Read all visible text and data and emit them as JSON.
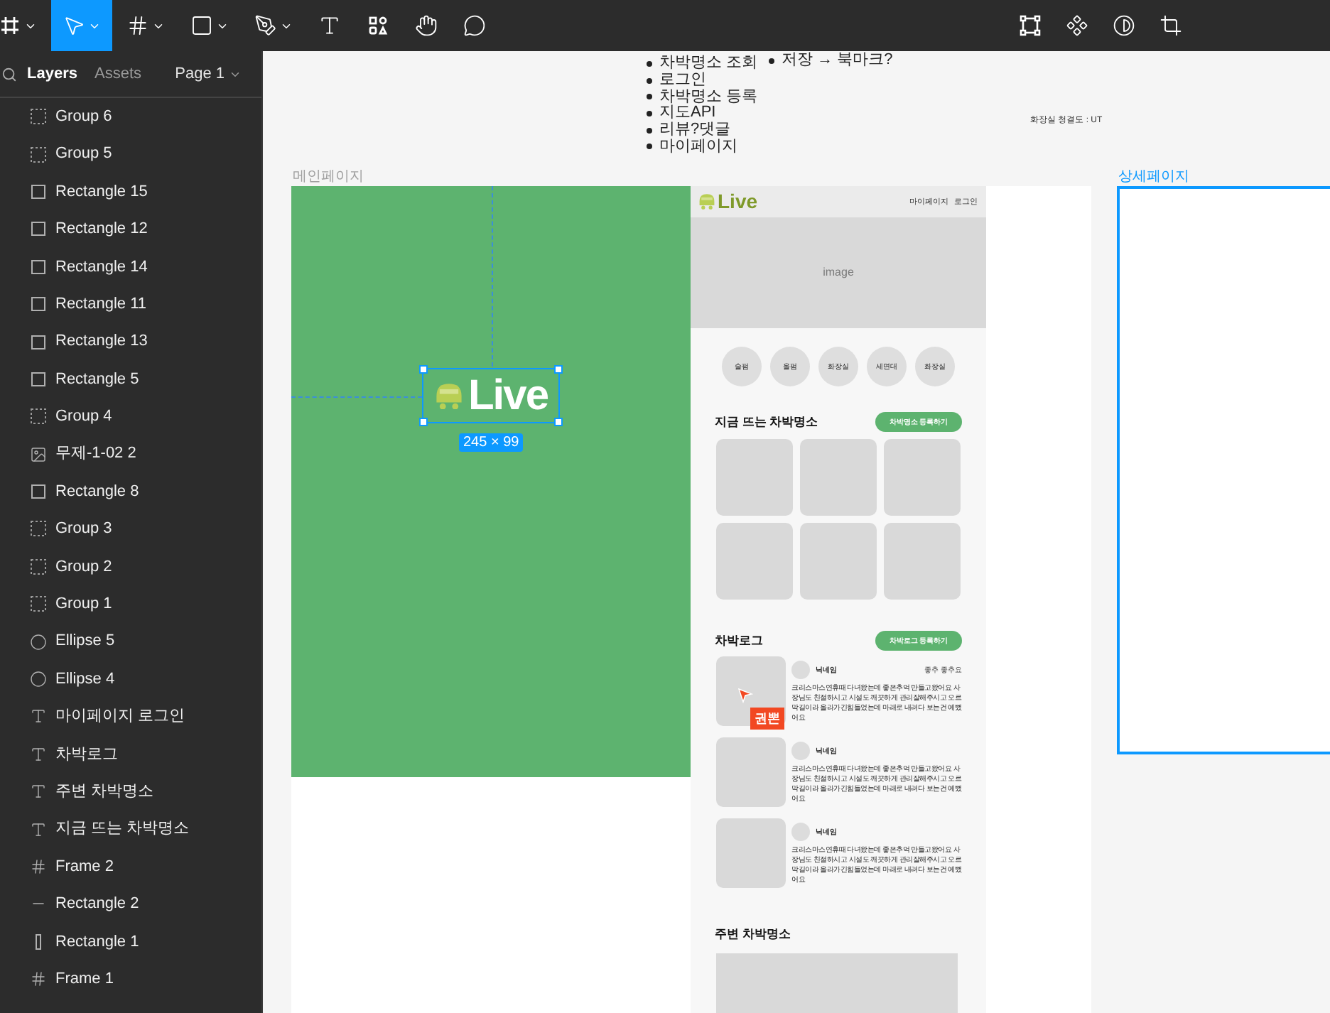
{
  "toolbar": {
    "tools": [
      {
        "kind": "menu",
        "selected": false,
        "menu": true
      },
      {
        "kind": "move",
        "selected": true,
        "menu": true
      },
      {
        "kind": "frame",
        "selected": false,
        "menu": true
      },
      {
        "kind": "rectangle",
        "selected": false,
        "menu": true
      },
      {
        "kind": "pen",
        "selected": false,
        "menu": true
      },
      {
        "kind": "text",
        "selected": false,
        "menu": false
      },
      {
        "kind": "resources",
        "selected": false,
        "menu": false
      },
      {
        "kind": "hand",
        "selected": false,
        "menu": false
      },
      {
        "kind": "comment",
        "selected": false,
        "menu": false
      }
    ],
    "right_tools": [
      {
        "kind": "frame-selection"
      },
      {
        "kind": "component"
      },
      {
        "kind": "contrast"
      },
      {
        "kind": "crop"
      }
    ]
  },
  "layers_panel": {
    "tabs": [
      {
        "label": "Layers",
        "selected": true
      },
      {
        "label": "Assets",
        "selected": false
      }
    ],
    "page": "Page 1",
    "layers": [
      {
        "name": "Group 6",
        "kind": "group"
      },
      {
        "name": "Group 5",
        "kind": "group"
      },
      {
        "name": "Rectangle 15",
        "kind": "rectangle"
      },
      {
        "name": "Rectangle 12",
        "kind": "rectangle"
      },
      {
        "name": "Rectangle 14",
        "kind": "rectangle"
      },
      {
        "name": "Rectangle 11",
        "kind": "rectangle"
      },
      {
        "name": "Rectangle 13",
        "kind": "rectangle"
      },
      {
        "name": "Rectangle 5",
        "kind": "rectangle"
      },
      {
        "name": "Group 4",
        "kind": "group"
      },
      {
        "name": "무제-1-02 2",
        "kind": "image"
      },
      {
        "name": "Rectangle 8",
        "kind": "rectangle"
      },
      {
        "name": "Group 3",
        "kind": "group"
      },
      {
        "name": "Group 2",
        "kind": "group"
      },
      {
        "name": "Group 1",
        "kind": "group"
      },
      {
        "name": "Ellipse 5",
        "kind": "ellipse"
      },
      {
        "name": "Ellipse 4",
        "kind": "ellipse"
      },
      {
        "name": "마이페이지 로그인",
        "kind": "text"
      },
      {
        "name": "차박로그",
        "kind": "text"
      },
      {
        "name": "주변 차박명소",
        "kind": "text"
      },
      {
        "name": "지금 뜨는 차박명소",
        "kind": "text"
      },
      {
        "name": "Frame 2",
        "kind": "frame"
      },
      {
        "name": "Rectangle 2",
        "kind": "line"
      },
      {
        "name": "Rectangle 1",
        "kind": "bar"
      },
      {
        "name": "Frame 1",
        "kind": "frame"
      }
    ]
  },
  "canvas": {
    "notes": [
      "차박명소 조회",
      "로그인",
      "차박명소 등록",
      "지도API",
      "리뷰?댓글",
      "마이페이지"
    ],
    "side_notes": [
      "저장 → 북마크?"
    ],
    "caption": "화장실 청결도 : UT",
    "main_frame": {
      "label": "메인페이지",
      "logo": "Live",
      "selection_size": "245 × 99",
      "design": {
        "logo": "Live",
        "nav": [
          "마이페이지",
          "로그인"
        ],
        "banner": "image",
        "categories": [
          "술펌",
          "올펌",
          "화장실",
          "세면대",
          "화장실"
        ],
        "hot": {
          "title": "지금 뜨는 차박명소",
          "button": "차박명소 등록하기"
        },
        "log": {
          "title": "차박로그",
          "button": "차박로그 등록하기",
          "entries": [
            {
              "name": "닉네임",
              "tag": "좋추 좋추요",
              "text": "크리스마스연휴때 다녀왔는데 좋은추억 만들고왔어요 사장님도 친절하시고 시설도 깨끗하게 관리잘해주시고 오르막길이라 올라가긴힘들었는데 마래로 내려다 보는건 예뻤어요",
              "cursor": {
                "name": "권뽄",
                "color": "#f24822"
              }
            },
            {
              "name": "닉네임",
              "text": "크리스마스연휴때 다녀왔는데 좋은추억 만들고왔어요 사장님도 친절하시고 시설도 깨끗하게 관리잘해주시고 오르막길이라 올라가긴힘들었는데 마래로 내려다 보는건 예뻤어요"
            },
            {
              "name": "닉네임",
              "text": "크리스마스연휴때 다녀왔는데 좋은추억 만들고왔어요 사장님도 친절하시고 시설도 깨끗하게 관리잘해주시고 오르막길이라 올라가긴힘들었는데 마래로 내려다 보는건 예뻤어요"
            }
          ]
        },
        "nearby": {
          "title": "주변 차박명소"
        }
      }
    },
    "detail_frame": {
      "label": "상세페이지",
      "selected": true
    }
  }
}
